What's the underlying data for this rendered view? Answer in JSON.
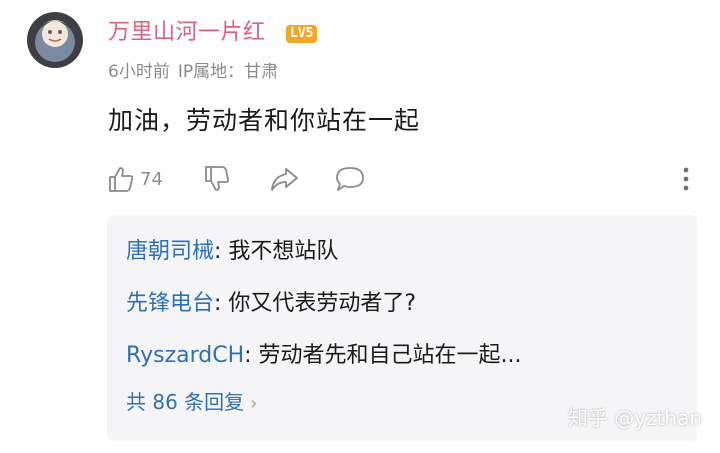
{
  "comment": {
    "author": "万里山河一片红",
    "level_badge": "LV5",
    "time": "6小时前",
    "ip_location": "IP属地：甘肃",
    "text": "加油，劳动者和你站在一起",
    "like_count": "74"
  },
  "replies": {
    "items": [
      {
        "author": "唐朝司械",
        "text": ": 我不想站队"
      },
      {
        "author": "先锋电台",
        "text": ": 你又代表劳动者了?"
      },
      {
        "author": "RyszardCH",
        "text": ": 劳动者先和自己站在一起..."
      }
    ],
    "view_all_label": "共 86 条回复"
  },
  "watermark": "知乎 @yzthan",
  "colors": {
    "username": "#e35d82",
    "reply_author": "#2f6fb5",
    "badge": "#f5a623",
    "reply_bg": "#f5f5f7"
  },
  "icons": {
    "like": "thumbs-up-icon",
    "dislike": "thumbs-down-icon",
    "share": "share-arrow-icon",
    "reply": "speech-bubble-icon",
    "more": "more-vertical-icon",
    "chevron": "chevron-right-icon"
  }
}
